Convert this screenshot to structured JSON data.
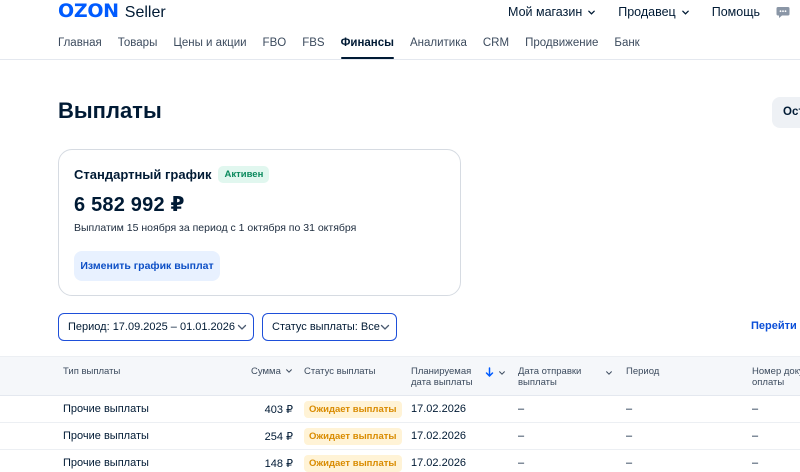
{
  "header": {
    "logo": "OZON",
    "logo_sub": "Seller",
    "top_nav": [
      {
        "label": "Мой магазин",
        "has_chevron": true
      },
      {
        "label": "Продавец",
        "has_chevron": true
      },
      {
        "label": "Помощь",
        "has_chevron": false
      }
    ]
  },
  "main_nav": {
    "items": [
      "Главная",
      "Товары",
      "Цены и акции",
      "FBO",
      "FBS",
      "Финансы",
      "Аналитика",
      "CRM",
      "Продвижение",
      "Банк"
    ],
    "active": "Финансы"
  },
  "page": {
    "title": "Выплаты",
    "corner_button": "Ост"
  },
  "schedule": {
    "title": "Стандартный график",
    "badge": "Активен",
    "amount": "6 582 992 ₽",
    "description": "Выплатим 15 ноября за период с 1 октября по 31 октября",
    "change_button": "Изменить график выплат"
  },
  "filters": {
    "period": "Период: 17.09.2025 – 01.01.2026",
    "status": "Статус выплаты: Все",
    "link": "Перейти в"
  },
  "table": {
    "columns": {
      "type": "Тип выплаты",
      "sum": "Сумма",
      "status": "Статус выплаты",
      "planned_1": "Планируемая",
      "planned_2": "дата выплаты",
      "sent_1": "Дата отправки",
      "sent_2": "выплаты",
      "period": "Период",
      "number_1": "Номер доку",
      "number_2": "оплаты"
    },
    "rows": [
      {
        "type": "Прочие выплаты",
        "sum": "403 ₽",
        "status": "Ожидает выплаты",
        "planned": "17.02.2026",
        "sent": "–",
        "period": "–",
        "number": "–"
      },
      {
        "type": "Прочие выплаты",
        "sum": "254 ₽",
        "status": "Ожидает выплаты",
        "planned": "17.02.2026",
        "sent": "–",
        "period": "–",
        "number": "–"
      },
      {
        "type": "Прочие выплаты",
        "sum": "148 ₽",
        "status": "Ожидает выплаты",
        "planned": "17.02.2026",
        "sent": "–",
        "period": "–",
        "number": "–"
      }
    ]
  },
  "colors": {
    "brand": "#005bff",
    "active_badge_bg": "#e1f7ef",
    "active_badge_text": "#0c8a5e",
    "pending_bg": "#fff3d6",
    "pending_text": "#d98b00",
    "filter_border": "#1e4fd9"
  },
  "icons": [
    "chevron-down-icon",
    "chat-icon",
    "sort-arrow-down-icon"
  ]
}
